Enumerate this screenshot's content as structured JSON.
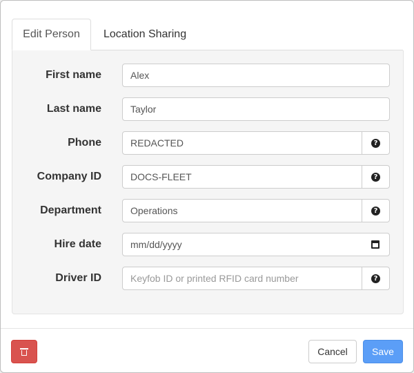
{
  "tabs": [
    {
      "label": "Edit Person",
      "active": true
    },
    {
      "label": "Location Sharing",
      "active": false
    }
  ],
  "form": {
    "first_name": {
      "label": "First name",
      "value": "Alex"
    },
    "last_name": {
      "label": "Last name",
      "value": "Taylor"
    },
    "phone": {
      "label": "Phone",
      "value": "REDACTED",
      "help_icon": "question-circle-icon"
    },
    "company_id": {
      "label": "Company ID",
      "value": "DOCS-FLEET",
      "help_icon": "question-circle-icon"
    },
    "department": {
      "label": "Department",
      "value": "Operations",
      "help_icon": "question-circle-icon"
    },
    "hire_date": {
      "label": "Hire date",
      "placeholder": "mm/dd/yyyy",
      "icon": "calendar-icon"
    },
    "driver_id": {
      "label": "Driver ID",
      "value": "",
      "placeholder": "Keyfob ID or printed RFID card number",
      "help_icon": "question-circle-icon"
    }
  },
  "footer": {
    "delete_icon": "trash-icon",
    "cancel_label": "Cancel",
    "save_label": "Save"
  },
  "colors": {
    "danger": "#d9534f",
    "primary": "#5b9ef7",
    "panel_bg": "#f5f5f5"
  }
}
